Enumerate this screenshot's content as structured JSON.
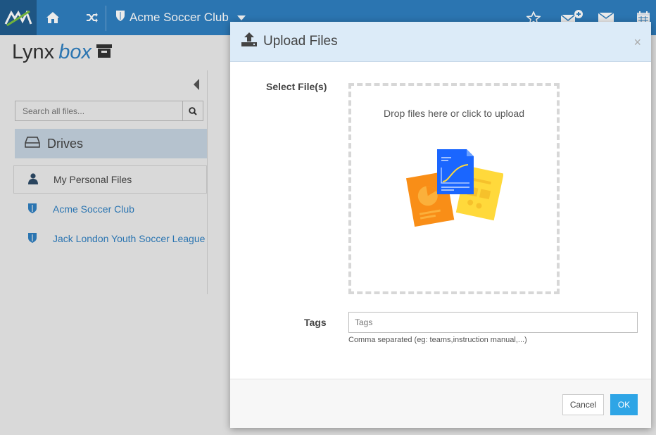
{
  "topbar": {
    "club_name": "Acme Soccer Club",
    "icons": [
      "logo-icon",
      "home-icon",
      "shuffle-icon",
      "shield-icon",
      "caret-down-icon",
      "star-icon",
      "envelope-plus-icon",
      "envelope-icon",
      "calendar-icon"
    ]
  },
  "brand": {
    "lynx": "Lynx",
    "box": "box"
  },
  "search": {
    "placeholder": "Search all files..."
  },
  "sidebar": {
    "drives_label": "Drives",
    "items": [
      {
        "label": "My Personal Files",
        "icon": "user-icon"
      },
      {
        "label": "Acme Soccer Club",
        "icon": "shield-icon"
      },
      {
        "label": "Jack London Youth Soccer League",
        "icon": "shield-icon"
      }
    ]
  },
  "modal": {
    "title": "Upload Files",
    "close": "×",
    "select_label": "Select File(s)",
    "drop_hint": "Drop files here or click to upload",
    "tags_label": "Tags",
    "tags_placeholder": "Tags",
    "tags_help": "Comma separated (eg: teams,instruction manual,...)",
    "cancel_label": "Cancel",
    "ok_label": "OK"
  },
  "colors": {
    "brand_blue": "#2f7fc1",
    "header_bg": "#dcebf8",
    "ok_button": "#2ea5e6"
  }
}
